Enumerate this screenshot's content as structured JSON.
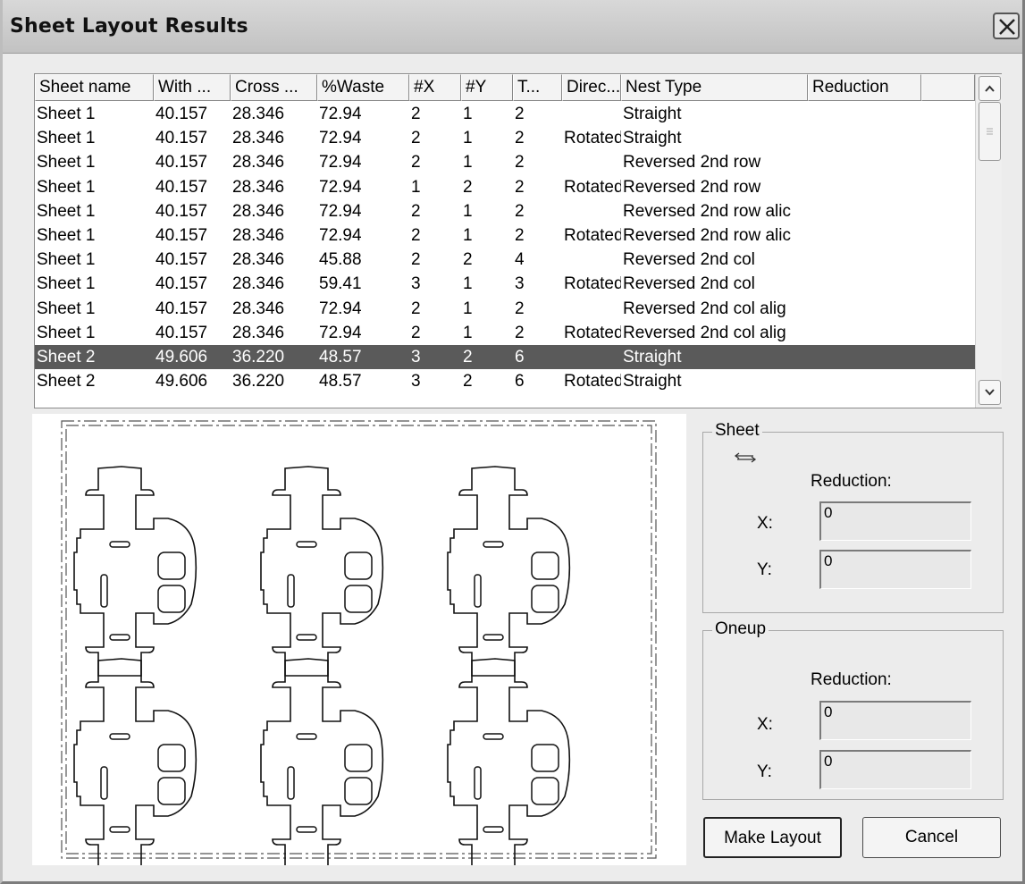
{
  "window": {
    "title": "Sheet Layout Results"
  },
  "columns": [
    "Sheet name",
    "With ...",
    "Cross ...",
    "%Waste",
    "#X",
    "#Y",
    "T...",
    "Direc...",
    "Nest Type",
    "Reduction"
  ],
  "rows": [
    [
      "Sheet 1",
      "40.157",
      "28.346",
      "72.94",
      "2",
      "1",
      "2",
      "",
      "Straight",
      ""
    ],
    [
      "Sheet 1",
      "40.157",
      "28.346",
      "72.94",
      "2",
      "1",
      "2",
      "Rotated",
      "Straight",
      ""
    ],
    [
      "Sheet 1",
      "40.157",
      "28.346",
      "72.94",
      "2",
      "1",
      "2",
      "",
      "Reversed 2nd row",
      ""
    ],
    [
      "Sheet 1",
      "40.157",
      "28.346",
      "72.94",
      "1",
      "2",
      "2",
      "Rotated",
      "Reversed 2nd row",
      ""
    ],
    [
      "Sheet 1",
      "40.157",
      "28.346",
      "72.94",
      "2",
      "1",
      "2",
      "",
      "Reversed 2nd row alic",
      ""
    ],
    [
      "Sheet 1",
      "40.157",
      "28.346",
      "72.94",
      "2",
      "1",
      "2",
      "Rotated",
      "Reversed 2nd row alic",
      ""
    ],
    [
      "Sheet 1",
      "40.157",
      "28.346",
      "45.88",
      "2",
      "2",
      "4",
      "",
      "Reversed 2nd col",
      ""
    ],
    [
      "Sheet 1",
      "40.157",
      "28.346",
      "59.41",
      "3",
      "1",
      "3",
      "Rotated",
      "Reversed 2nd col",
      ""
    ],
    [
      "Sheet 1",
      "40.157",
      "28.346",
      "72.94",
      "2",
      "1",
      "2",
      "",
      "Reversed 2nd col alig",
      ""
    ],
    [
      "Sheet 1",
      "40.157",
      "28.346",
      "72.94",
      "2",
      "1",
      "2",
      "Rotated",
      "Reversed 2nd col alig",
      ""
    ],
    [
      "Sheet 2",
      "49.606",
      "36.220",
      "48.57",
      "3",
      "2",
      "6",
      "",
      "Straight",
      ""
    ],
    [
      "Sheet 2",
      "49.606",
      "36.220",
      "48.57",
      "3",
      "2",
      "6",
      "Rotated",
      "Straight",
      ""
    ]
  ],
  "selected_row": 10,
  "preview": {
    "columns": 3,
    "rows": 2
  },
  "sheet_group": {
    "label": "Sheet",
    "reduction_label": "Reduction:",
    "x_label": "X:",
    "x_value": "0",
    "y_label": "Y:",
    "y_value": "0"
  },
  "oneup_group": {
    "label": "Oneup",
    "reduction_label": "Reduction:",
    "x_label": "X:",
    "x_value": "0",
    "y_label": "Y:",
    "y_value": "0"
  },
  "buttons": {
    "make_layout": "Make Layout",
    "cancel": "Cancel"
  },
  "icons": {
    "close": "close-icon",
    "swap": "swap-arrows-icon",
    "scroll_up": "chevron-up-icon",
    "scroll_down": "chevron-down-icon"
  }
}
